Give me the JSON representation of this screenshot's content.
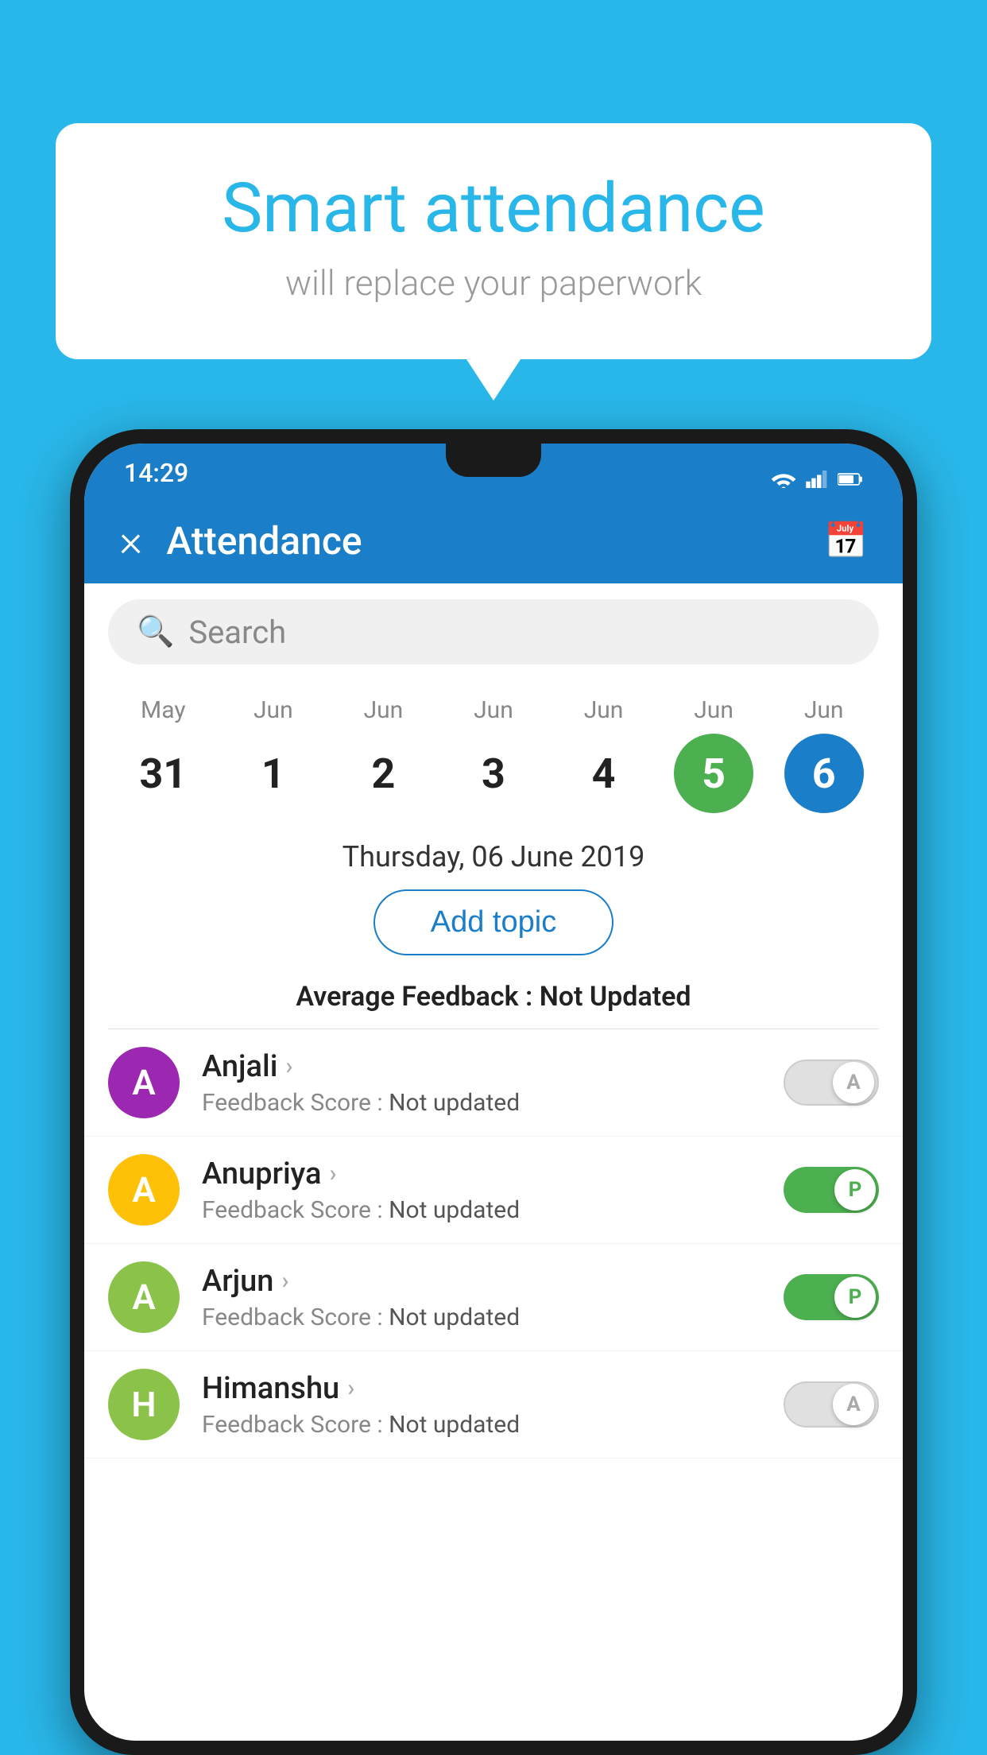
{
  "background_color": "#29b6e8",
  "bubble": {
    "title": "Smart attendance",
    "subtitle": "will replace your paperwork"
  },
  "status_bar": {
    "time": "14:29"
  },
  "app_bar": {
    "close_label": "×",
    "title": "Attendance",
    "calendar_icon": "📅"
  },
  "search": {
    "placeholder": "Search"
  },
  "calendar": {
    "days": [
      {
        "month": "May",
        "date": "31",
        "state": "normal"
      },
      {
        "month": "Jun",
        "date": "1",
        "state": "normal"
      },
      {
        "month": "Jun",
        "date": "2",
        "state": "normal"
      },
      {
        "month": "Jun",
        "date": "3",
        "state": "normal"
      },
      {
        "month": "Jun",
        "date": "4",
        "state": "normal"
      },
      {
        "month": "Jun",
        "date": "5",
        "state": "today"
      },
      {
        "month": "Jun",
        "date": "6",
        "state": "selected"
      }
    ]
  },
  "selected_date_label": "Thursday, 06 June 2019",
  "add_topic_label": "Add topic",
  "average_feedback": {
    "label": "Average Feedback :",
    "value": "Not Updated"
  },
  "students": [
    {
      "name": "Anjali",
      "avatar_letter": "A",
      "avatar_color": "#9c27b0",
      "feedback_label": "Feedback Score :",
      "feedback_value": "Not updated",
      "toggle": "off",
      "toggle_letter": "A"
    },
    {
      "name": "Anupriya",
      "avatar_letter": "A",
      "avatar_color": "#ffc107",
      "feedback_label": "Feedback Score :",
      "feedback_value": "Not updated",
      "toggle": "on",
      "toggle_letter": "P"
    },
    {
      "name": "Arjun",
      "avatar_letter": "A",
      "avatar_color": "#8bc34a",
      "feedback_label": "Feedback Score :",
      "feedback_value": "Not updated",
      "toggle": "on",
      "toggle_letter": "P"
    },
    {
      "name": "Himanshu",
      "avatar_letter": "H",
      "avatar_color": "#8bc34a",
      "feedback_label": "Feedback Score :",
      "feedback_value": "Not updated",
      "toggle": "off",
      "toggle_letter": "A"
    }
  ]
}
